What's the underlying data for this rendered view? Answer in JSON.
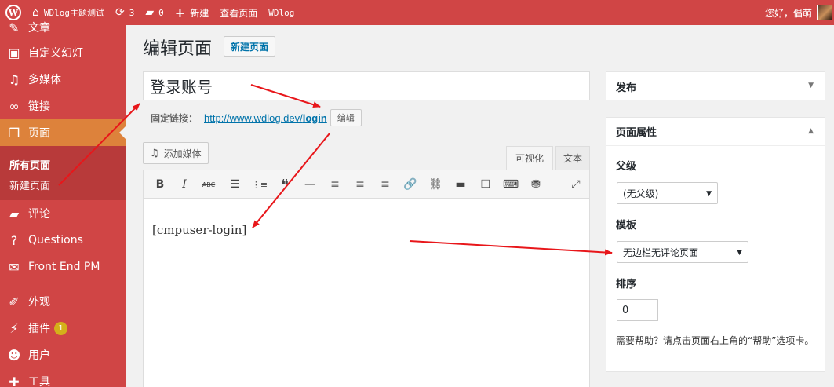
{
  "adminbar": {
    "site_name": "WDlog主题测试",
    "updates_count": "3",
    "comments_count": "0",
    "new_label": "新建",
    "view_page": "查看页面",
    "wdlog": "WDlog",
    "greeting": "您好，倡萌"
  },
  "sidebar": {
    "items": [
      {
        "label": "文章",
        "icon": "pin-icon"
      },
      {
        "label": "自定义幻灯",
        "icon": "slides-icon"
      },
      {
        "label": "多媒体",
        "icon": "media-icon"
      },
      {
        "label": "链接",
        "icon": "link-icon"
      },
      {
        "label": "页面",
        "icon": "page-icon"
      },
      {
        "label": "评论",
        "icon": "comment-icon"
      },
      {
        "label": "Questions",
        "icon": "question-icon"
      },
      {
        "label": "Front End PM",
        "icon": "mail-icon"
      },
      {
        "label": "外观",
        "icon": "brush-icon"
      },
      {
        "label": "插件",
        "icon": "plugin-icon"
      },
      {
        "label": "用户",
        "icon": "user-icon"
      },
      {
        "label": "工具",
        "icon": "tools-icon"
      }
    ],
    "submenu": {
      "all_pages": "所有页面",
      "new_page": "新建页面"
    },
    "plugin_badge": "1"
  },
  "main": {
    "heading": "编辑页面",
    "new_page_button": "新建页面",
    "title_value": "登录账号",
    "permalink_label": "固定链接：",
    "permalink_base": "http://www.wdlog.dev/",
    "permalink_slug": "login",
    "edit_button": "编辑",
    "add_media": "添加媒体",
    "tab_visual": "可视化",
    "tab_text": "文本",
    "content": "[cmpuser-login]"
  },
  "publish_box": {
    "title": "发布"
  },
  "attributes_box": {
    "title": "页面属性",
    "parent_label": "父级",
    "parent_value": "(无父级)",
    "template_label": "模板",
    "template_value": "无边栏无评论页面",
    "order_label": "排序",
    "order_value": "0",
    "help_text": "需要帮助？请点击页面右上角的“帮助”选项卡。"
  },
  "colors": {
    "admin_red": "#d04545",
    "current_orange": "#dd823b",
    "submenu_red": "#b83a3a",
    "link_blue": "#0073aa",
    "arrow_red": "#e8161a"
  }
}
